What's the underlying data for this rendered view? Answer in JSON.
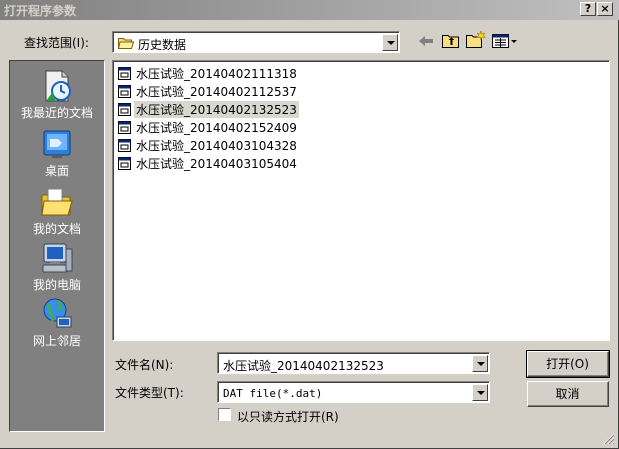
{
  "window": {
    "title": "打开程序参数",
    "help_label": "?",
    "close_label": "×"
  },
  "lookin": {
    "label": "查找范围(I):",
    "value": "历史数据"
  },
  "places": [
    {
      "label": "我最近的文档",
      "icon": "recent-documents-icon"
    },
    {
      "label": "桌面",
      "icon": "desktop-icon"
    },
    {
      "label": "我的文档",
      "icon": "my-documents-icon"
    },
    {
      "label": "我的电脑",
      "icon": "my-computer-icon"
    },
    {
      "label": "网上邻居",
      "icon": "network-places-icon"
    }
  ],
  "files": [
    {
      "name": "水压试验_20140402111318",
      "selected": false
    },
    {
      "name": "水压试验_20140402112537",
      "selected": false
    },
    {
      "name": "水压试验_20140402132523",
      "selected": true
    },
    {
      "name": "水压试验_20140402152409",
      "selected": false
    },
    {
      "name": "水压试验_20140403104328",
      "selected": false
    },
    {
      "name": "水压试验_20140403105404",
      "selected": false
    }
  ],
  "filename": {
    "label": "文件名(N):",
    "value": "水压试验_20140402132523"
  },
  "filetype": {
    "label": "文件类型(T):",
    "value": "DAT file(*.dat)"
  },
  "readonly": {
    "label": "以只读方式打开(R)",
    "checked": false
  },
  "buttons": {
    "open": "打开(O)",
    "cancel": "取消"
  }
}
